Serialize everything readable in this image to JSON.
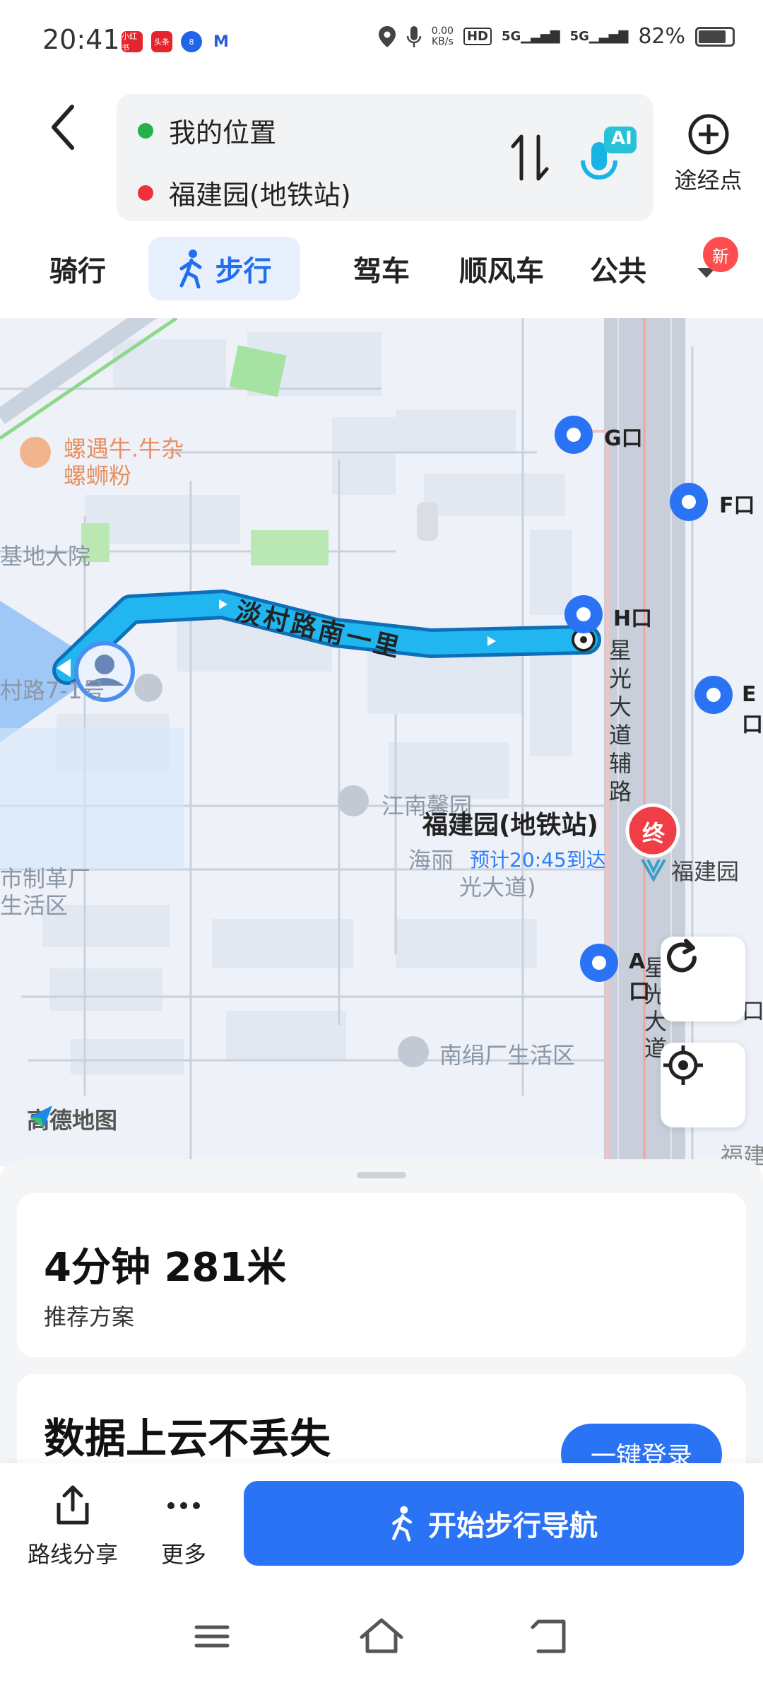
{
  "status": {
    "time": "20:41",
    "net_speed_value": "0.00",
    "net_speed_unit": "KB/s",
    "battery": "82%",
    "battery_level": 0.82,
    "apps": [
      "小红书",
      "头条",
      "8",
      "M"
    ]
  },
  "route": {
    "from": "我的位置",
    "to": "福建园(地铁站)",
    "ai_badge": "AI",
    "via_label": "途经点"
  },
  "modes": {
    "tabs": [
      "骑行",
      "步行",
      "驾车",
      "顺风车",
      "公共"
    ],
    "active": "步行",
    "new_badge": "新"
  },
  "map": {
    "road_label": "淡村路南一里",
    "poi_food_1": "螺遇牛.牛杂",
    "poi_food_2": "螺蛳粉",
    "poi_base": "基地大院",
    "poi_road7": "村路7-1号",
    "poi_jiangnan": "江南馨园",
    "poi_factory_1": "市制革厂",
    "poi_factory_2": "生活区",
    "poi_nanjuan": "南绢厂生活区",
    "poi_haili": "海丽",
    "poi_guang": "光大道)",
    "avenue_side": "星光大道辅路",
    "avenue": "星光大道",
    "destination": "福建园(地铁站)",
    "eta": "预计20:45到达",
    "end_marker": "终",
    "station_label": "福建园",
    "exits": [
      "G口",
      "F口",
      "H口",
      "E口",
      "A口"
    ],
    "brand": "高德地图",
    "partial_label_right": "口",
    "partial_label_bottom": "福建"
  },
  "plan": {
    "summary": "4分钟  281米",
    "label": "推荐方案"
  },
  "promo": {
    "title": "数据上云不丢失",
    "button": "一键登录"
  },
  "bottom": {
    "share": "路线分享",
    "more": "更多",
    "start": "开始步行导航"
  },
  "colors": {
    "accent": "#2b73f5",
    "route": "#1fb4f0",
    "start_dot": "#22b14c",
    "end_dot": "#f0313b"
  }
}
